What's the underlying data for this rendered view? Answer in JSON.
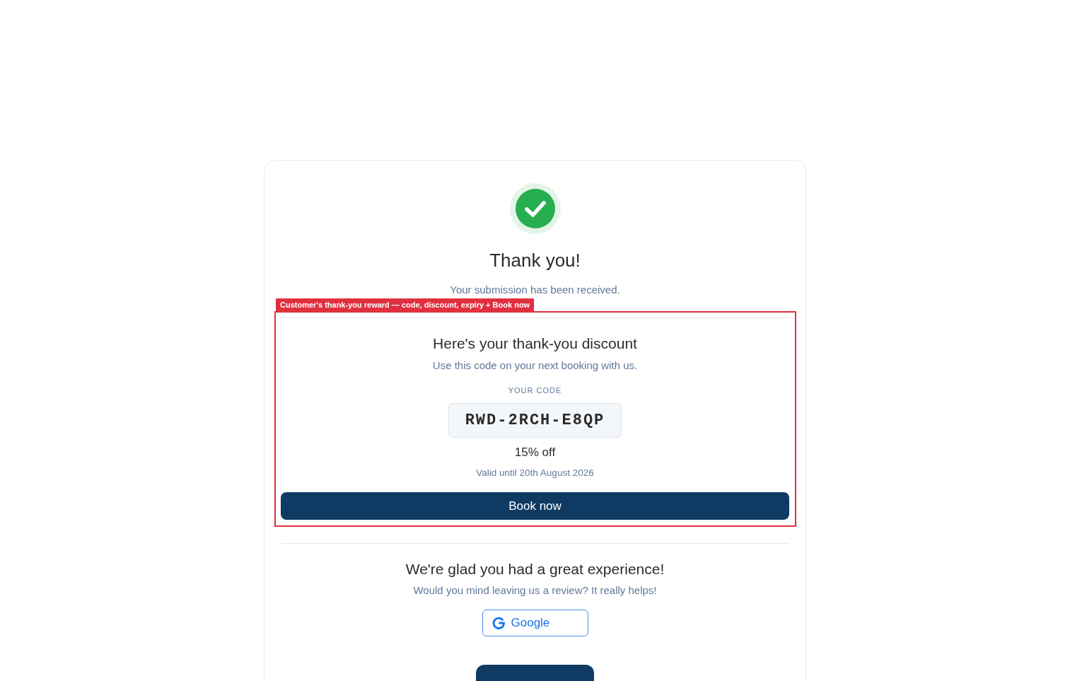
{
  "status": {
    "title": "Thank you!",
    "message": "Your submission has been received."
  },
  "annotation": {
    "label": "Customer's thank-you reward — code, discount, expiry + Book now"
  },
  "reward": {
    "title": "Here's your thank-you discount",
    "subtitle": "Use this code on your next booking with us.",
    "code_label": "YOUR CODE",
    "code": "RWD-2RCH-E8QP",
    "discount": "15% off",
    "expiry": "Valid until 20th August 2026",
    "button": "Book now"
  },
  "review": {
    "title": "We're glad you had a great experience!",
    "subtitle": "Would you mind leaving us a review? It really helps!",
    "buttons": [
      {
        "kind": "google",
        "label": "Google"
      }
    ]
  },
  "actions": [
    {
      "kind": "primary"
    }
  ]
}
